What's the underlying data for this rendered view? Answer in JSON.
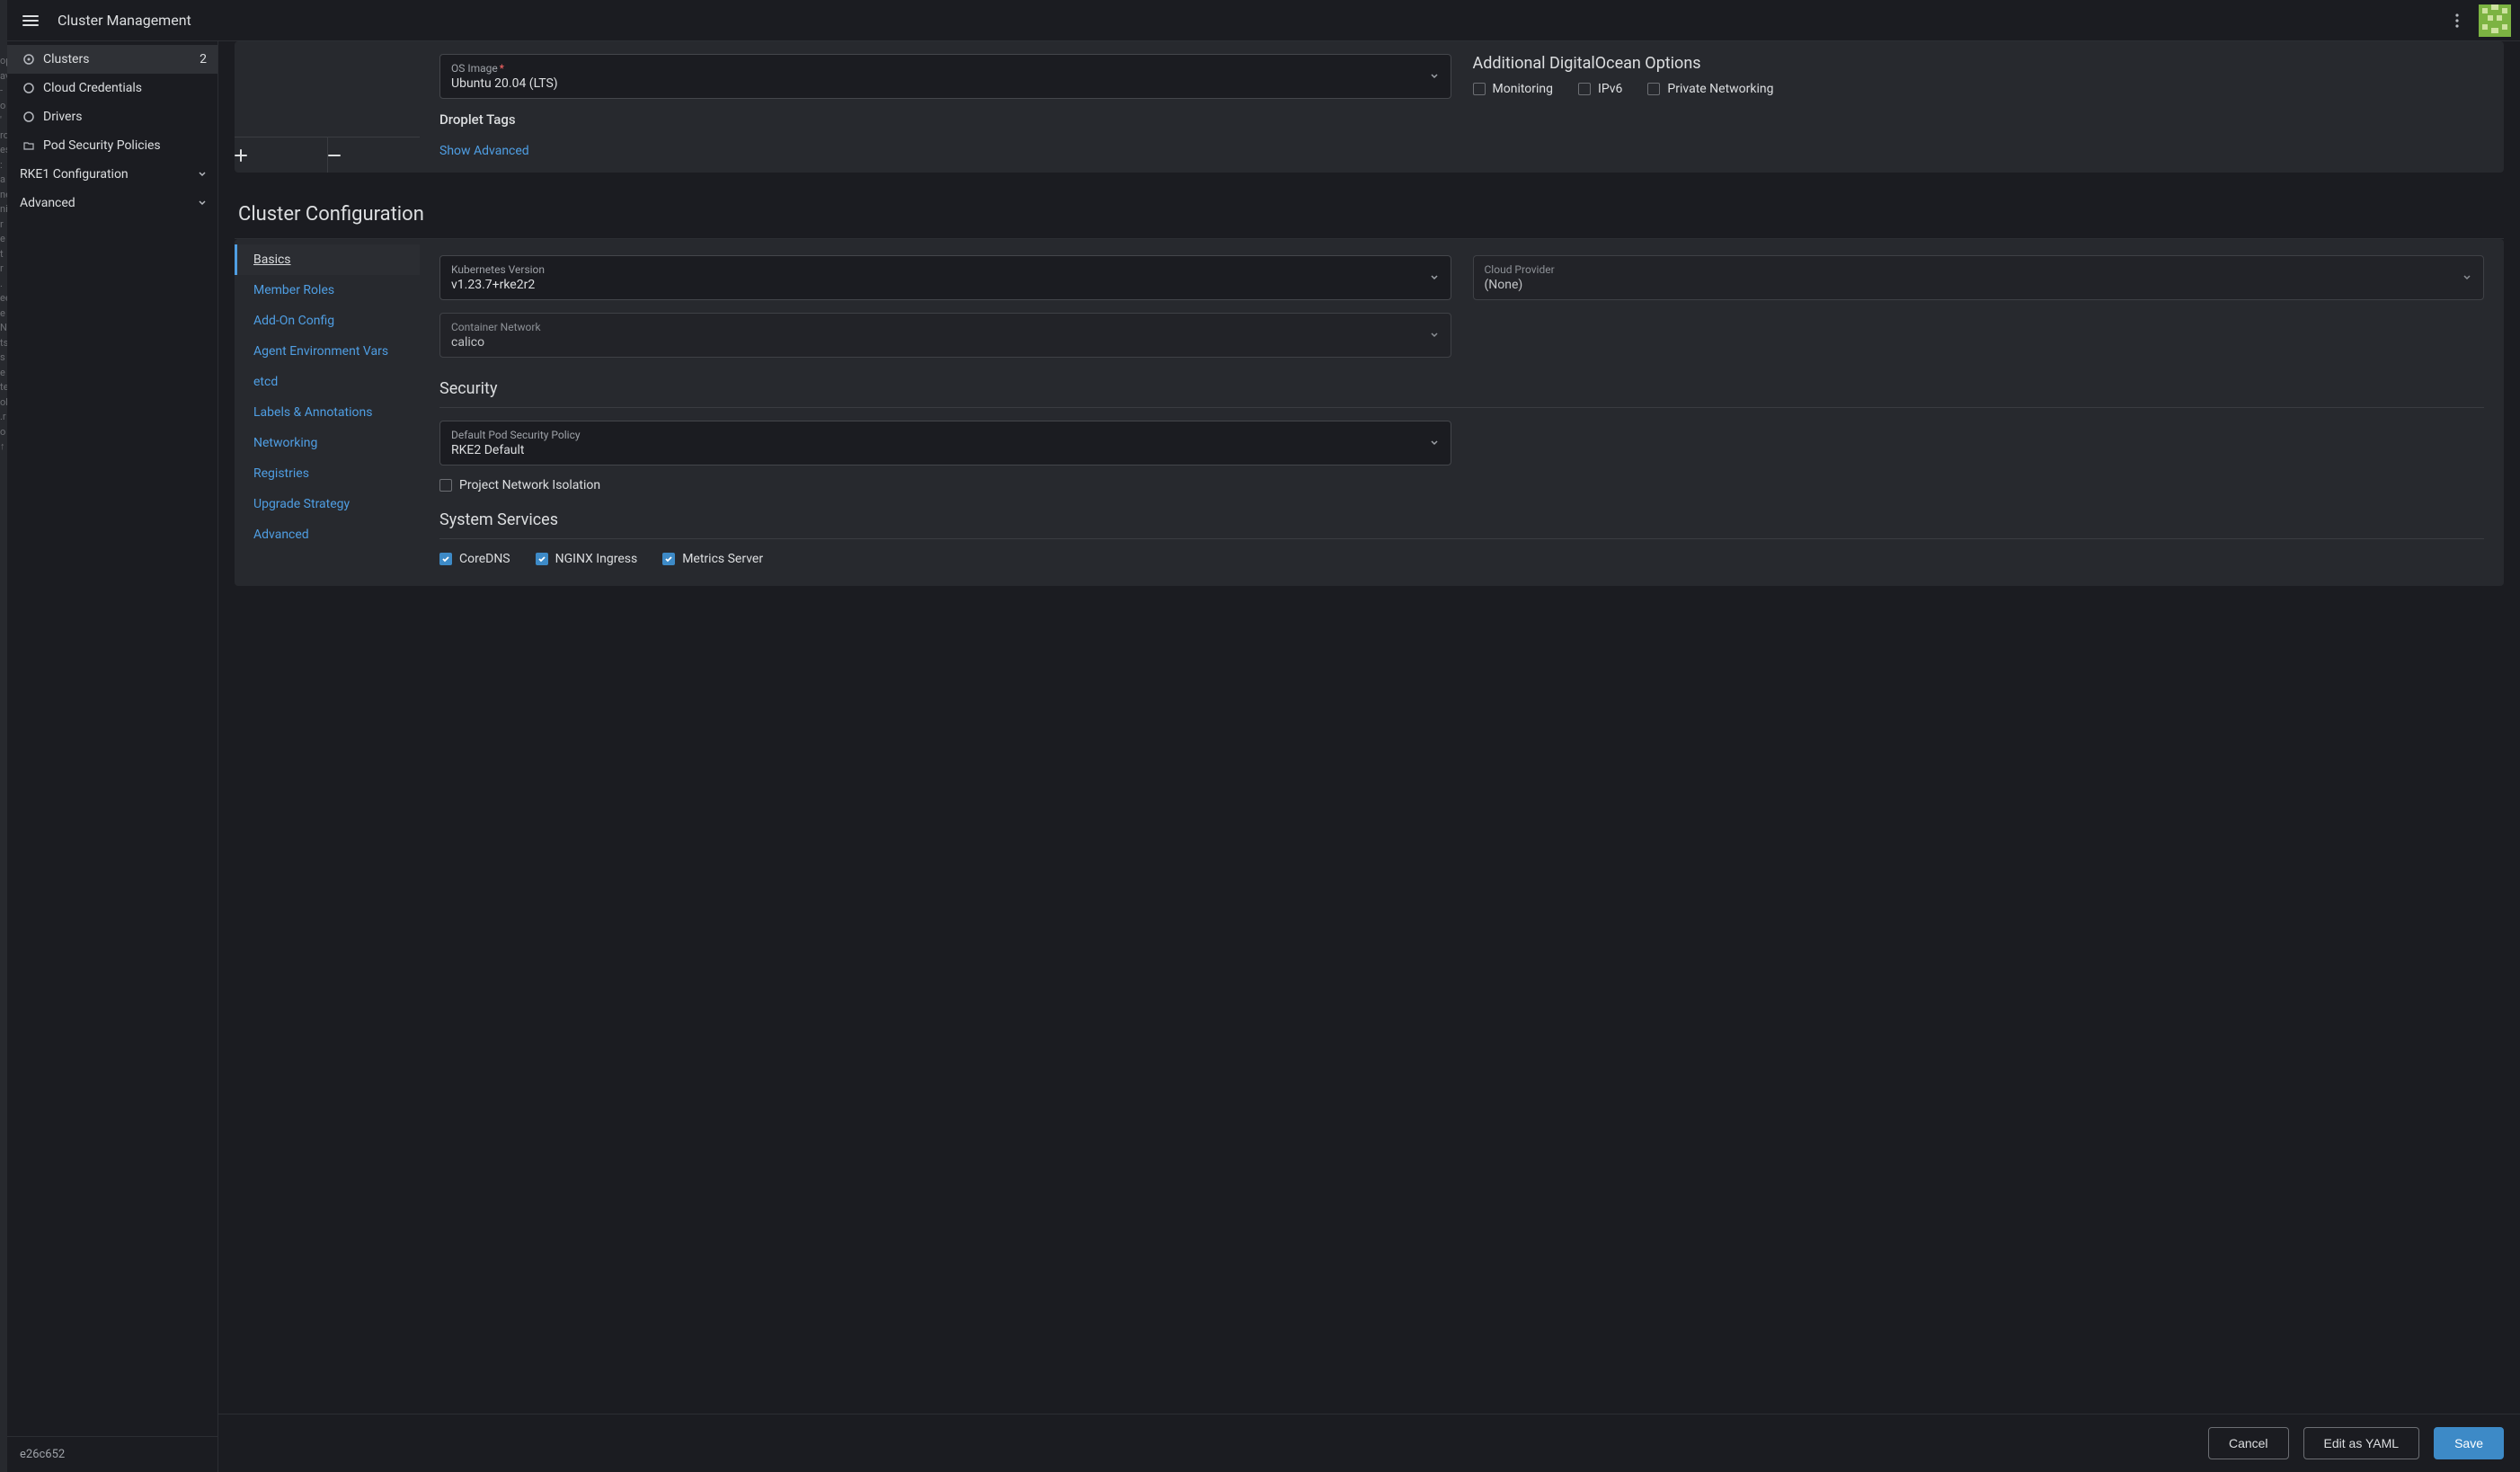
{
  "header": {
    "title": "Cluster Management"
  },
  "sidebar": {
    "items": [
      {
        "label": "Clusters",
        "badge": "2",
        "active": true
      },
      {
        "label": "Cloud Credentials"
      },
      {
        "label": "Drivers"
      },
      {
        "label": "Pod Security Policies"
      }
    ],
    "groups": [
      {
        "label": "RKE1 Configuration"
      },
      {
        "label": "Advanced"
      }
    ],
    "version": "e26c652"
  },
  "top_panel": {
    "os_image": {
      "label": "OS Image",
      "value": "Ubuntu 20.04 (LTS)",
      "required": true
    },
    "droplet_tags_heading": "Droplet Tags",
    "show_advanced": "Show Advanced",
    "options_heading": "Additional DigitalOcean Options",
    "options": [
      {
        "label": "Monitoring",
        "checked": false
      },
      {
        "label": "IPv6",
        "checked": false
      },
      {
        "label": "Private Networking",
        "checked": false
      }
    ]
  },
  "cluster_config": {
    "heading": "Cluster Configuration",
    "tabs": [
      {
        "label": "Basics",
        "active": true
      },
      {
        "label": "Member Roles"
      },
      {
        "label": "Add-On Config"
      },
      {
        "label": "Agent Environment Vars"
      },
      {
        "label": "etcd"
      },
      {
        "label": "Labels & Annotations"
      },
      {
        "label": "Networking"
      },
      {
        "label": "Registries"
      },
      {
        "label": "Upgrade Strategy"
      },
      {
        "label": "Advanced"
      }
    ],
    "k8s_version": {
      "label": "Kubernetes Version",
      "value": "v1.23.7+rke2r2"
    },
    "cloud_provider": {
      "label": "Cloud Provider",
      "value": "(None)"
    },
    "container_network": {
      "label": "Container Network",
      "value": "calico"
    },
    "security_heading": "Security",
    "psp": {
      "label": "Default Pod Security Policy",
      "value": "RKE2 Default"
    },
    "pni": {
      "label": "Project Network Isolation",
      "checked": false
    },
    "system_services_heading": "System Services",
    "services": [
      {
        "label": "CoreDNS",
        "checked": true
      },
      {
        "label": "NGINX Ingress",
        "checked": true
      },
      {
        "label": "Metrics Server",
        "checked": true
      }
    ]
  },
  "footer": {
    "cancel": "Cancel",
    "yaml": "Edit as YAML",
    "save": "Save"
  }
}
